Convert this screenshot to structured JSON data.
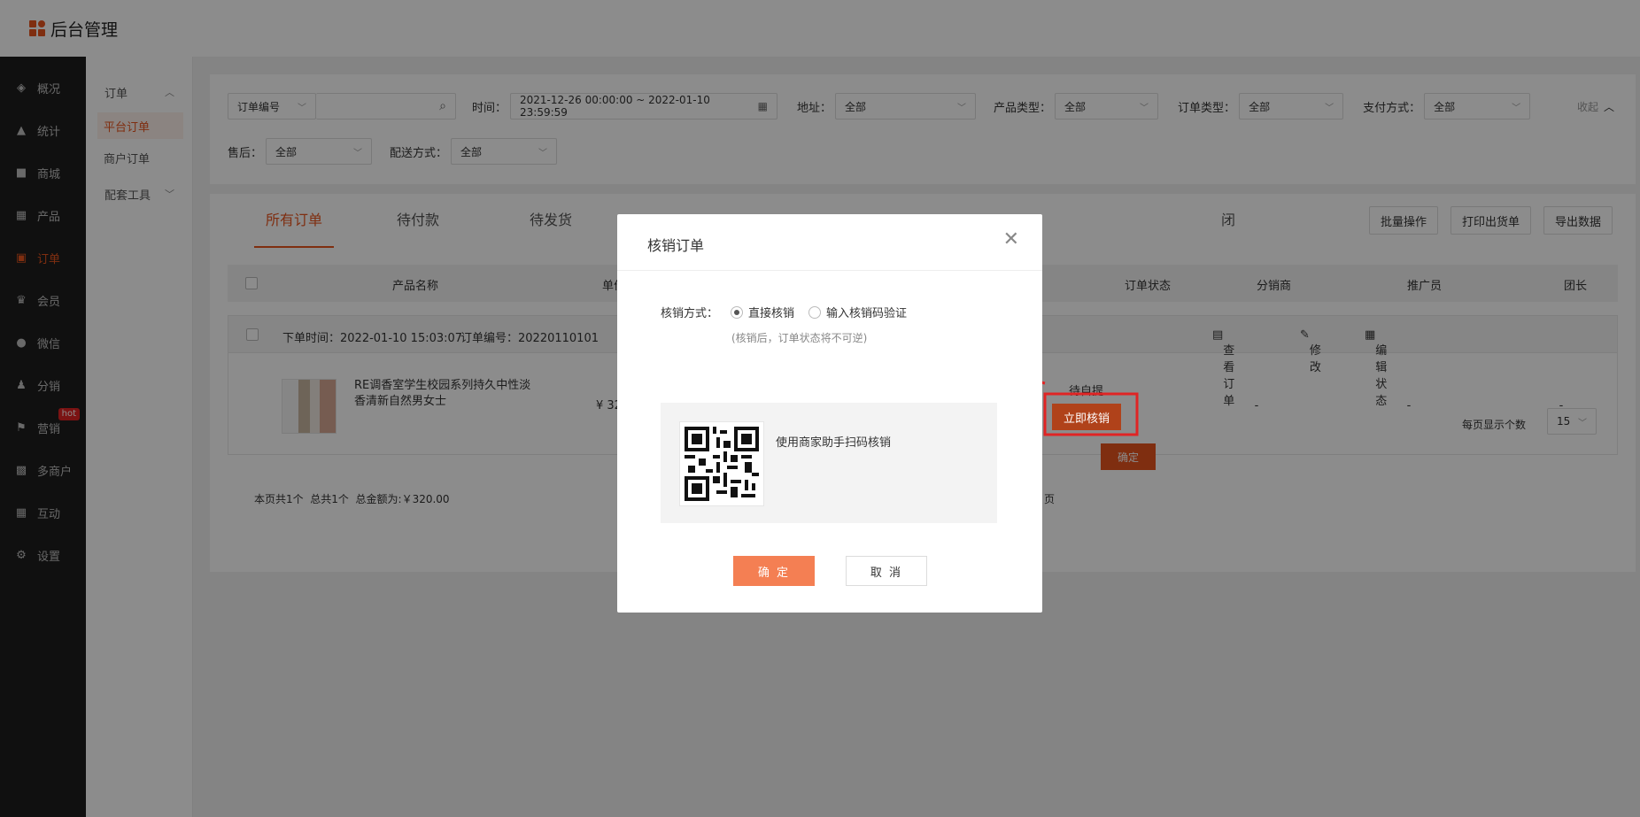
{
  "header": {
    "title": "后台管理"
  },
  "sidebar": {
    "items": [
      {
        "label": "概况",
        "icon": "dashboard-icon"
      },
      {
        "label": "统计",
        "icon": "chart-icon"
      },
      {
        "label": "商城",
        "icon": "mall-icon"
      },
      {
        "label": "产品",
        "icon": "product-icon"
      },
      {
        "label": "订单",
        "icon": "order-icon"
      },
      {
        "label": "会员",
        "icon": "crown-icon"
      },
      {
        "label": "微信",
        "icon": "wechat-icon"
      },
      {
        "label": "分销",
        "icon": "distribution-icon"
      },
      {
        "label": "营销",
        "icon": "flag-icon"
      },
      {
        "label": "多商户",
        "icon": "merchant-icon"
      },
      {
        "label": "互动",
        "icon": "interaction-icon"
      },
      {
        "label": "设置",
        "icon": "gear-icon"
      }
    ],
    "hot_badge": "hot"
  },
  "subsidebar": {
    "group": "订单",
    "items": [
      "平台订单",
      "商户订单"
    ],
    "tools": "配套工具"
  },
  "filters": {
    "search_type": "订单编号",
    "time_label": "时间：",
    "time_value": "2021-12-26 00:00:00 ~ 2022-01-10 23:59:59",
    "address_label": "地址：",
    "address_value": "全部",
    "product_type_label": "产品类型：",
    "product_type_value": "全部",
    "order_type_label": "订单类型：",
    "order_type_value": "全部",
    "payment_label": "支付方式：",
    "payment_value": "全部",
    "collapse": "收起",
    "aftersale_label": "售后：",
    "aftersale_value": "全部",
    "delivery_label": "配送方式：",
    "delivery_value": "全部"
  },
  "tabs": [
    "所有订单",
    "待付款",
    "待发货",
    "闭"
  ],
  "actions": {
    "batch": "批量操作",
    "print": "打印出货单",
    "export": "导出数据"
  },
  "table": {
    "headers": [
      "产品名称",
      "单价",
      "订单状态",
      "分销商",
      "推广员",
      "团长"
    ]
  },
  "order": {
    "time": "下单时间：2022-01-10 15:03:07",
    "number": "订单编号：20220110101",
    "view": "查看订单",
    "edit": "修改",
    "edit_status": "编辑状态",
    "product_name": "RE调香室学生校园系列持久中性淡香清新自然男女士",
    "price": "¥ 32",
    "status": "待自提",
    "verify_button": "立即核销",
    "distributor": "-",
    "promoter": "-",
    "leader": "-"
  },
  "pagination": {
    "summary": "本页共1个  总共1个  总金额为:￥320.00",
    "page_size_label": "每页显示个数",
    "page_size": "15",
    "page_suffix": "页",
    "confirm": "确定"
  },
  "modal": {
    "title": "核销订单",
    "method_label": "核销方式：",
    "option_direct": "直接核销",
    "option_code": "输入核销码验证",
    "hint": "(核销后，订单状态将不可逆)",
    "qr_text": "使用商家助手扫码核销",
    "confirm": "确 定",
    "cancel": "取 消"
  },
  "colors": {
    "accent": "#e8541e",
    "confirm": "#f47f53",
    "annotation": "#e02424"
  }
}
